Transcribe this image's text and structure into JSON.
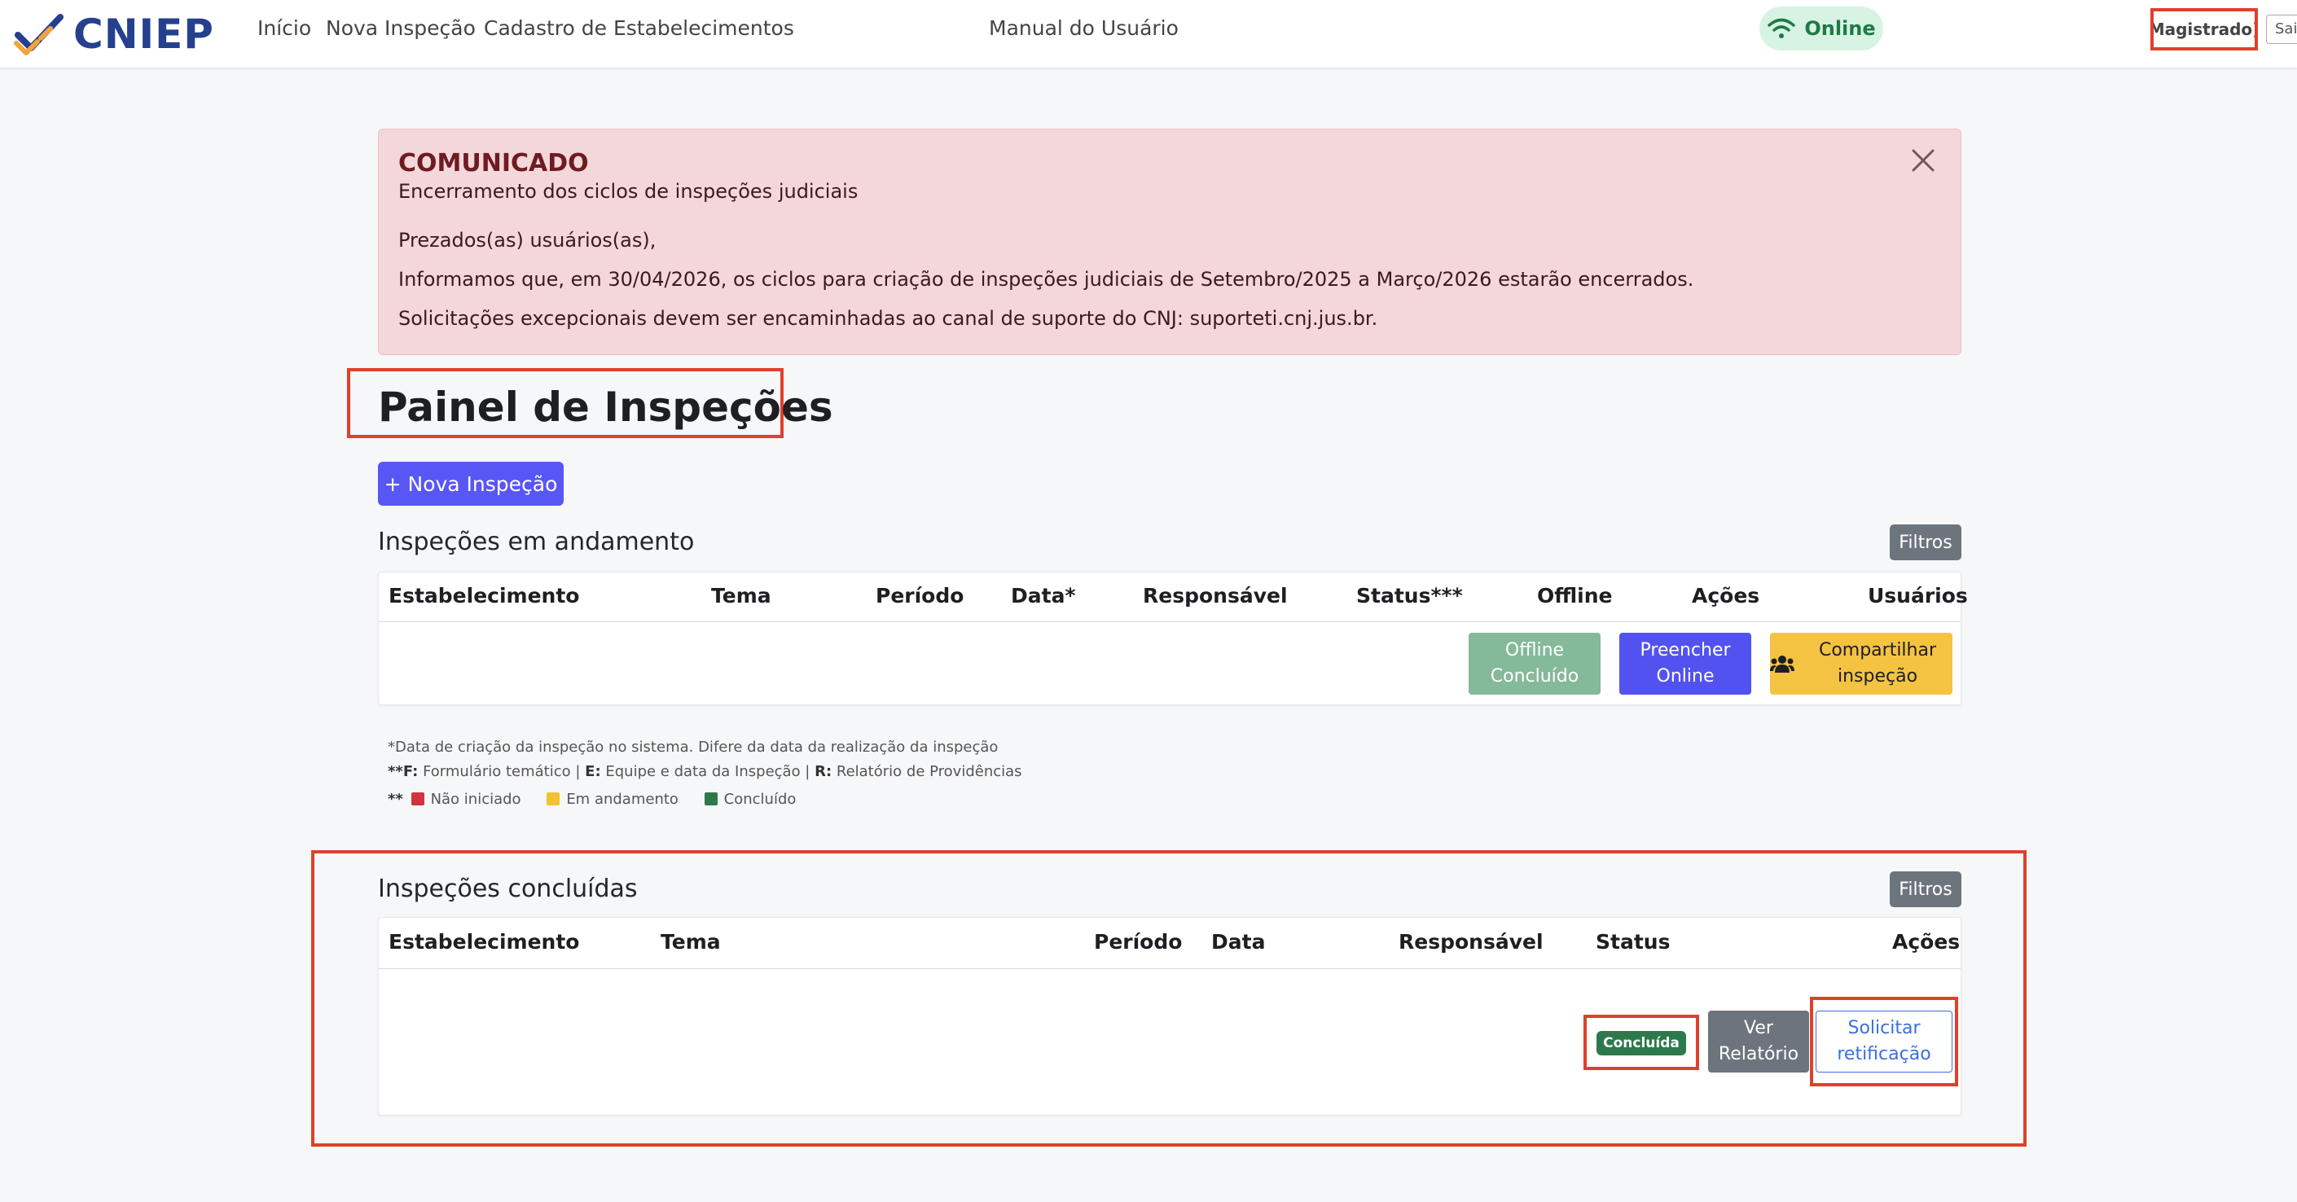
{
  "brand": {
    "name": "CNIEP",
    "colors": {
      "primary": "#24408e",
      "accent": "#f1a53a"
    }
  },
  "nav": {
    "items": [
      "Início",
      "Nova Inspeção",
      "Cadastro de Estabelecimentos",
      "Manual do Usuário"
    ],
    "status": "Online",
    "user": "Magistrado)",
    "logout": "Sai"
  },
  "alert": {
    "title": "COMUNICADO",
    "subtitle": "Encerramento dos ciclos de inspeções judiciais",
    "greeting": "Prezados(as) usuários(as),",
    "message": "Informamos que, em 30/04/2026, os ciclos para criação de inspeções judiciais de Setembro/2025 a Março/2026 estarão encerrados.",
    "support": "Solicitações excepcionais devem ser encaminhadas ao canal de suporte do CNJ: suporteti.cnj.jus.br."
  },
  "page": {
    "title": "Painel de Inspeções",
    "new_button": "+ Nova Inspeção"
  },
  "ongoing": {
    "heading": "Inspeções em andamento",
    "filter": "Filtros",
    "columns": [
      "Estabelecimento",
      "Tema",
      "Período",
      "Data*",
      "Responsável",
      "Status***",
      "Offline",
      "Ações",
      "Usuários"
    ],
    "row": {
      "offline_button": "Offline Concluído",
      "fill_button": "Preencher Online",
      "share_button": "Compartilhar inspeção"
    }
  },
  "legend": {
    "note1": "*Data de criação da inspeção no sistema. Difere da data da realização da inspeção",
    "note2_prefix": "**",
    "note2_f": "F:",
    "note2_f_text": " Formulário temático | ",
    "note2_e": "E:",
    "note2_e_text": " Equipe e data da Inspeção | ",
    "note2_r": "R:",
    "note2_r_text": " Relatório de Providências",
    "note3_prefix": "**",
    "statuses": [
      "Não iniciado",
      "Em andamento",
      "Concluído"
    ],
    "status_colors": [
      "#d0343f",
      "#f1c232",
      "#2c7a4b"
    ]
  },
  "completed": {
    "heading": "Inspeções concluídas",
    "filter": "Filtros",
    "columns": [
      "Estabelecimento",
      "Tema",
      "Período",
      "Data",
      "Responsável",
      "Status",
      "Ações"
    ],
    "row": {
      "status": "Concluída",
      "report_button": "Ver Relatório",
      "rectify_button": "Solicitar retificação"
    }
  }
}
